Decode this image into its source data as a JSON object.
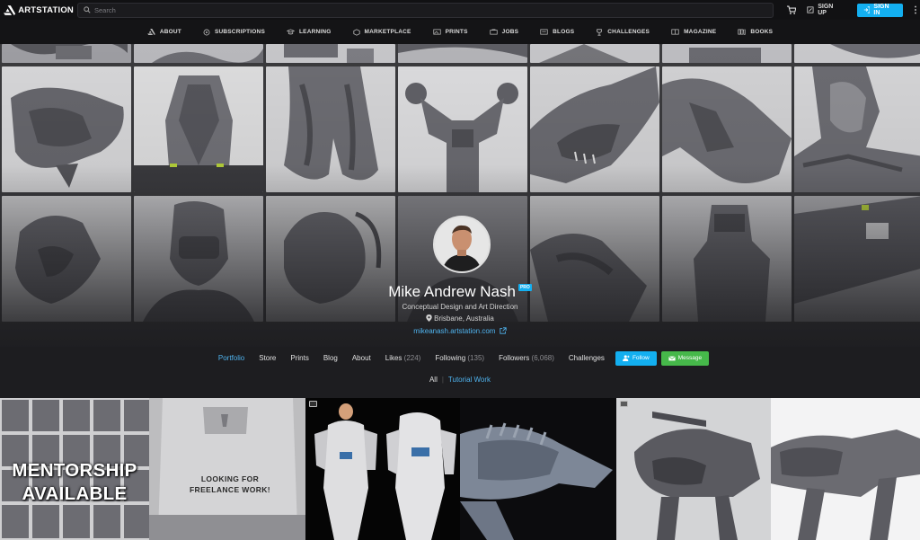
{
  "header": {
    "logo_text": "ARTSTATION",
    "search_placeholder": "Search",
    "signup_label": "SIGN UP",
    "signin_label": "SIGN IN",
    "accent_color": "#13aff0"
  },
  "nav": {
    "items": [
      {
        "label": "ABOUT",
        "icon": "artstation-icon"
      },
      {
        "label": "SUBSCRIPTIONS",
        "icon": "subscriptions-icon"
      },
      {
        "label": "LEARNING",
        "icon": "learning-icon"
      },
      {
        "label": "MARKETPLACE",
        "icon": "marketplace-icon"
      },
      {
        "label": "PRINTS",
        "icon": "prints-icon"
      },
      {
        "label": "JOBS",
        "icon": "jobs-icon"
      },
      {
        "label": "BLOGS",
        "icon": "blogs-icon"
      },
      {
        "label": "CHALLENGES",
        "icon": "challenges-icon"
      },
      {
        "label": "MAGAZINE",
        "icon": "magazine-icon"
      },
      {
        "label": "BOOKS",
        "icon": "books-icon"
      }
    ]
  },
  "profile": {
    "name": "Mike Andrew Nash",
    "badge": "PRO",
    "headline": "Conceptual Design and Art Direction",
    "location": "Brisbane, Australia",
    "website": "mikeanash.artstation.com"
  },
  "tabs": {
    "portfolio": "Portfolio",
    "store": "Store",
    "prints": "Prints",
    "blog": "Blog",
    "about": "About",
    "likes": "Likes",
    "likes_count": "(224)",
    "following": "Following",
    "following_count": "(135)",
    "followers": "Followers",
    "followers_count": "(6,068)",
    "challenges": "Challenges",
    "follow_button": "Follow",
    "message_button": "Message"
  },
  "filters": {
    "all": "All",
    "tutorial": "Tutorial Work"
  },
  "gallery": {
    "mentorship_line1": "MENTORSHIP",
    "mentorship_line2": "AVAILABLE",
    "freelance_line1": "LOOKING FOR",
    "freelance_line2": "FREELANCE WORK!"
  }
}
